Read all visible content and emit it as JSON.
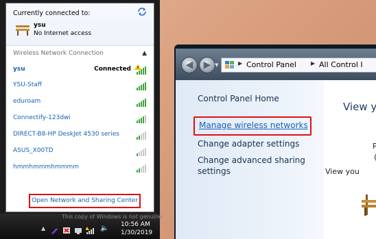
{
  "flyout": {
    "currently_connected_label": "Currently connected to:",
    "current_network": {
      "name": "ysu",
      "status": "No Internet access"
    },
    "section_header": "Wireless Network Connection",
    "networks": [
      {
        "name": "ysu",
        "status": "Connected"
      },
      {
        "name": "YSU-Staff"
      },
      {
        "name": "eduroam"
      },
      {
        "name": "Connectify-123dwi"
      },
      {
        "name": "DIRECT-B8-HP DeskJet 4530 series"
      },
      {
        "name": "ASUS_X00TD"
      },
      {
        "name": "hmmhmmmhmmmm"
      }
    ],
    "open_center_link": "Open Network and Sharing Center"
  },
  "taskbar": {
    "genuine_notice": "This copy of Windows is not genuine",
    "time": "10:56 AM",
    "date": "1/30/2019"
  },
  "control_panel": {
    "breadcrumb": [
      "Control Panel",
      "All Control I"
    ],
    "sidebar": {
      "home": "Control Panel Home",
      "manage_wireless": "Manage wireless networks",
      "change_adapter": "Change adapter settings",
      "change_sharing_line1": "Change advanced sharing",
      "change_sharing_line2": "settings"
    },
    "main": {
      "title": "View y",
      "fragment_p": "P",
      "fragment_paren": "(",
      "fragment_view": "View you"
    }
  },
  "colors": {
    "highlight_border": "#e01010",
    "link_blue": "#1a5fb4",
    "signal_green": "#3aa53a",
    "warning_yellow": "#f2c200"
  },
  "icons": [
    "refresh-icon",
    "bench-network-icon",
    "chevron-up-icon",
    "signal-strength-icon",
    "warning-icon",
    "back-icon",
    "forward-icon",
    "control-panel-icon",
    "speaker-icon",
    "flag-icon"
  ]
}
